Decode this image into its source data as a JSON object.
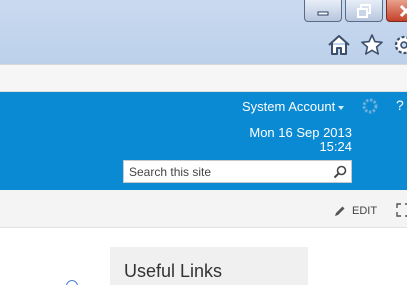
{
  "browser": {
    "window_buttons": [
      "minimize",
      "restore",
      "close"
    ],
    "toolbar_icons": [
      "home-icon",
      "star-icon",
      "gear-icon"
    ]
  },
  "suite_bar": {
    "account_label": "System Account",
    "date": "Mon 16 Sep 2013",
    "time": "15:24",
    "colors": {
      "background": "#0a8ad3",
      "text": "#ffffff"
    }
  },
  "search": {
    "placeholder": "Search this site"
  },
  "ribbon": {
    "edit_label": "EDIT"
  },
  "content": {
    "web_part_title": "Useful Links"
  }
}
